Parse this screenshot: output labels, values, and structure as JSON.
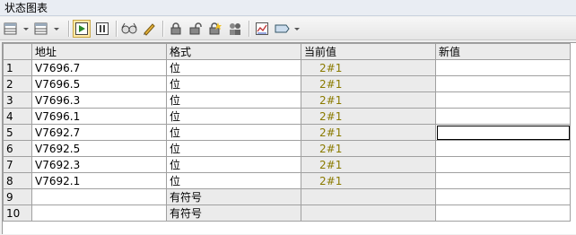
{
  "window": {
    "title": "状态图表"
  },
  "toolbar": {
    "icons": [
      "table-insert-icon",
      "table-delete-icon",
      "single-read-icon",
      "stop-read-icon",
      "watch-glasses-icon",
      "write-pencil-icon",
      "lock-icon",
      "unlock-icon",
      "force-add-icon",
      "group-icon",
      "trend-chart-icon",
      "tag-dropdown-icon"
    ]
  },
  "table": {
    "headers": {
      "row": "",
      "address": "地址",
      "format": "格式",
      "current": "当前值",
      "new": "新值"
    },
    "rows": [
      {
        "n": "1",
        "address": "V7696.7",
        "format": "位",
        "current": "2#1",
        "new": ""
      },
      {
        "n": "2",
        "address": "V7696.5",
        "format": "位",
        "current": "2#1",
        "new": ""
      },
      {
        "n": "3",
        "address": "V7696.3",
        "format": "位",
        "current": "2#1",
        "new": ""
      },
      {
        "n": "4",
        "address": "V7696.1",
        "format": "位",
        "current": "2#1",
        "new": ""
      },
      {
        "n": "5",
        "address": "V7692.7",
        "format": "位",
        "current": "2#1",
        "new": ""
      },
      {
        "n": "6",
        "address": "V7692.5",
        "format": "位",
        "current": "2#1",
        "new": ""
      },
      {
        "n": "7",
        "address": "V7692.3",
        "format": "位",
        "current": "2#1",
        "new": ""
      },
      {
        "n": "8",
        "address": "V7692.1",
        "format": "位",
        "current": "2#1",
        "new": ""
      },
      {
        "n": "9",
        "address": "",
        "format": "有符号",
        "current": "",
        "new": ""
      },
      {
        "n": "10",
        "address": "",
        "format": "有符号",
        "current": "",
        "new": ""
      }
    ]
  }
}
